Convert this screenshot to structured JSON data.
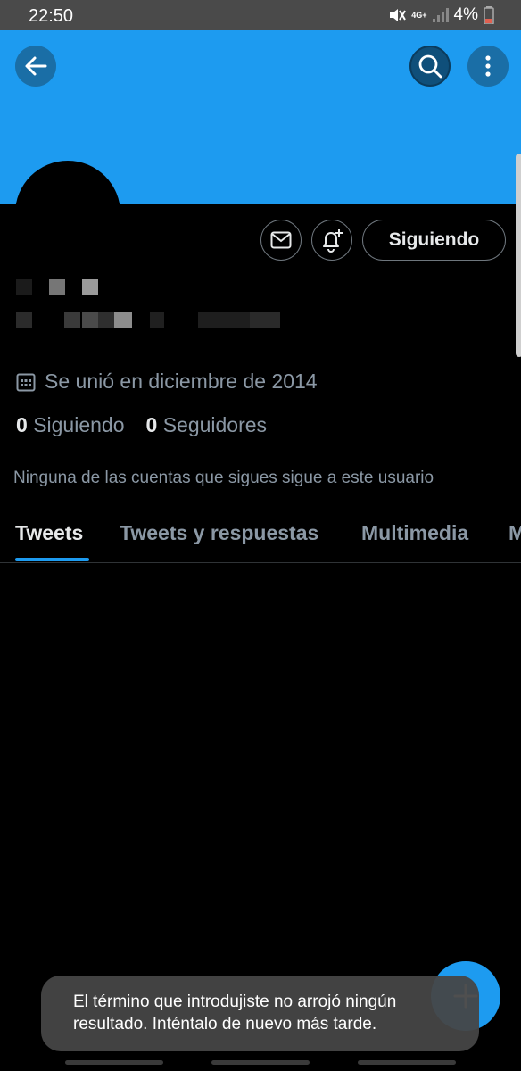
{
  "status_bar": {
    "time": "22:50",
    "network": "4G+",
    "battery": "4%"
  },
  "profile": {
    "follow_button": "Siguiendo",
    "joined": "Se unió en diciembre de 2014",
    "following_count": "0",
    "following_label": "Siguiendo",
    "followers_count": "0",
    "followers_label": "Seguidores",
    "no_mutual_followers": "Ninguna de las cuentas que sigues sigue a este usuario"
  },
  "tabs": [
    "Tweets",
    "Tweets y respuestas",
    "Multimedia",
    "M"
  ],
  "toast": {
    "message": "El término que introdujiste no arrojó ningún resultado. Inténtalo de nuevo más tarde."
  },
  "colors": {
    "accent": "#1d9bf0",
    "background": "#000000",
    "secondary_text": "#8b98a5"
  },
  "icons": [
    "back-arrow-icon",
    "search-icon",
    "more-vertical-icon",
    "envelope-icon",
    "bell-plus-icon",
    "calendar-icon",
    "plus-icon"
  ]
}
